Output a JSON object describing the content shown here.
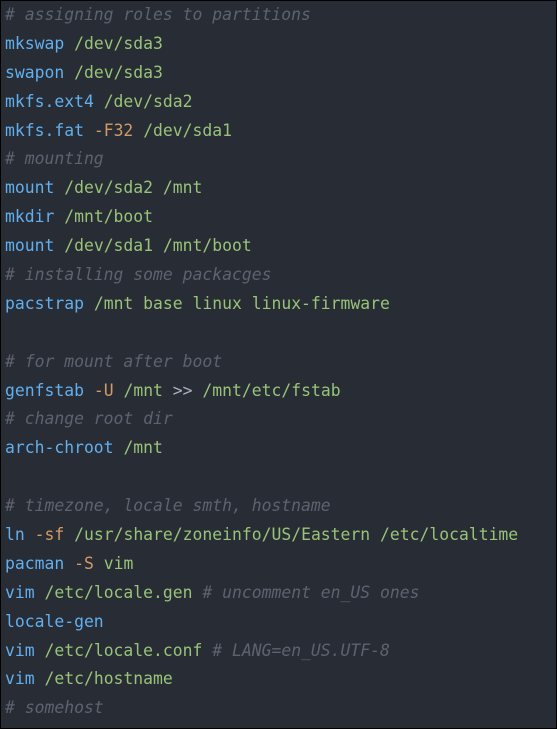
{
  "colors": {
    "background": "#282c34",
    "command": "#61afef",
    "argument": "#98c379",
    "flag": "#d19a66",
    "comment": "#5c6370",
    "plain": "#abb2bf"
  },
  "lines": [
    {
      "tokens": [
        {
          "type": "comment",
          "text": "# assigning roles to partitions"
        }
      ]
    },
    {
      "tokens": [
        {
          "type": "cmd",
          "text": "mkswap"
        },
        {
          "type": "plain",
          "text": " "
        },
        {
          "type": "arg",
          "text": "/dev/sda3"
        }
      ]
    },
    {
      "tokens": [
        {
          "type": "cmd",
          "text": "swapon"
        },
        {
          "type": "plain",
          "text": " "
        },
        {
          "type": "arg",
          "text": "/dev/sda3"
        }
      ]
    },
    {
      "tokens": [
        {
          "type": "cmd",
          "text": "mkfs.ext4"
        },
        {
          "type": "plain",
          "text": " "
        },
        {
          "type": "arg",
          "text": "/dev/sda2"
        }
      ]
    },
    {
      "tokens": [
        {
          "type": "cmd",
          "text": "mkfs.fat"
        },
        {
          "type": "plain",
          "text": " "
        },
        {
          "type": "flag",
          "text": "-F32"
        },
        {
          "type": "plain",
          "text": " "
        },
        {
          "type": "arg",
          "text": "/dev/sda1"
        }
      ]
    },
    {
      "tokens": [
        {
          "type": "comment",
          "text": "# mounting"
        }
      ]
    },
    {
      "tokens": [
        {
          "type": "cmd",
          "text": "mount"
        },
        {
          "type": "plain",
          "text": " "
        },
        {
          "type": "arg",
          "text": "/dev/sda2 /mnt"
        }
      ]
    },
    {
      "tokens": [
        {
          "type": "cmd",
          "text": "mkdir"
        },
        {
          "type": "plain",
          "text": " "
        },
        {
          "type": "arg",
          "text": "/mnt/boot"
        }
      ]
    },
    {
      "tokens": [
        {
          "type": "cmd",
          "text": "mount"
        },
        {
          "type": "plain",
          "text": " "
        },
        {
          "type": "arg",
          "text": "/dev/sda1 /mnt/boot"
        }
      ]
    },
    {
      "tokens": [
        {
          "type": "comment",
          "text": "# installing some packacges"
        }
      ]
    },
    {
      "tokens": [
        {
          "type": "cmd",
          "text": "pacstrap"
        },
        {
          "type": "plain",
          "text": " "
        },
        {
          "type": "arg",
          "text": "/mnt base linux linux-firmware"
        }
      ]
    },
    {
      "tokens": []
    },
    {
      "tokens": [
        {
          "type": "comment",
          "text": "# for mount after boot"
        }
      ]
    },
    {
      "tokens": [
        {
          "type": "cmd",
          "text": "genfstab"
        },
        {
          "type": "plain",
          "text": " "
        },
        {
          "type": "flag",
          "text": "-U"
        },
        {
          "type": "plain",
          "text": " "
        },
        {
          "type": "arg",
          "text": "/mnt"
        },
        {
          "type": "op",
          "text": " >> "
        },
        {
          "type": "arg",
          "text": "/mnt/etc/fstab"
        }
      ]
    },
    {
      "tokens": [
        {
          "type": "comment",
          "text": "# change root dir"
        }
      ]
    },
    {
      "tokens": [
        {
          "type": "cmd",
          "text": "arch-chroot"
        },
        {
          "type": "plain",
          "text": " "
        },
        {
          "type": "arg",
          "text": "/mnt"
        }
      ]
    },
    {
      "tokens": []
    },
    {
      "tokens": [
        {
          "type": "comment",
          "text": "# timezone, locale smth, hostname"
        }
      ]
    },
    {
      "tokens": [
        {
          "type": "cmd",
          "text": "ln"
        },
        {
          "type": "plain",
          "text": " "
        },
        {
          "type": "flag",
          "text": "-sf"
        },
        {
          "type": "plain",
          "text": " "
        },
        {
          "type": "arg",
          "text": "/usr/share/zoneinfo/US/Eastern /etc/localtime"
        }
      ]
    },
    {
      "tokens": [
        {
          "type": "cmd",
          "text": "pacman"
        },
        {
          "type": "plain",
          "text": " "
        },
        {
          "type": "flag",
          "text": "-S"
        },
        {
          "type": "plain",
          "text": " "
        },
        {
          "type": "arg",
          "text": "vim"
        }
      ]
    },
    {
      "tokens": [
        {
          "type": "cmd",
          "text": "vim"
        },
        {
          "type": "plain",
          "text": " "
        },
        {
          "type": "arg",
          "text": "/etc/locale.gen"
        },
        {
          "type": "plain",
          "text": " "
        },
        {
          "type": "comment",
          "text": "# uncomment en_US ones"
        }
      ]
    },
    {
      "tokens": [
        {
          "type": "cmd",
          "text": "locale-gen"
        }
      ]
    },
    {
      "tokens": [
        {
          "type": "cmd",
          "text": "vim"
        },
        {
          "type": "plain",
          "text": " "
        },
        {
          "type": "arg",
          "text": "/etc/locale.conf"
        },
        {
          "type": "plain",
          "text": " "
        },
        {
          "type": "comment",
          "text": "# LANG=en_US.UTF-8"
        }
      ]
    },
    {
      "tokens": [
        {
          "type": "cmd",
          "text": "vim"
        },
        {
          "type": "plain",
          "text": " "
        },
        {
          "type": "arg",
          "text": "/etc/hostname"
        }
      ]
    },
    {
      "tokens": [
        {
          "type": "comment",
          "text": "# somehost"
        }
      ]
    }
  ]
}
